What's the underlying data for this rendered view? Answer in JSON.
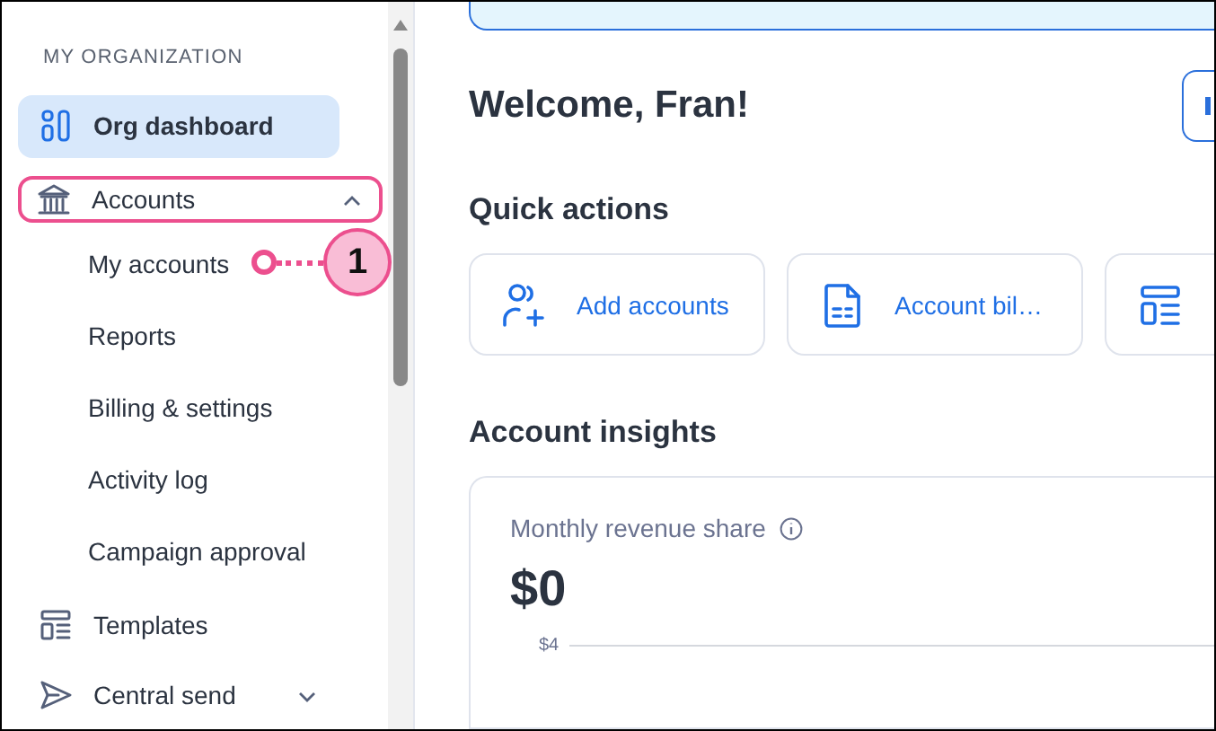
{
  "sidebar": {
    "section_label": "MY ORGANIZATION",
    "items": [
      {
        "kind": "dashboard",
        "label": "Org dashboard",
        "selected": true
      },
      {
        "kind": "bank",
        "label": "Accounts",
        "selected": false,
        "expanded": true,
        "highlighted": true,
        "children": [
          {
            "label": "My accounts",
            "selected": false
          },
          {
            "label": "Reports",
            "selected": false
          },
          {
            "label": "Billing & settings",
            "selected": false
          },
          {
            "label": "Activity log",
            "selected": false
          },
          {
            "label": "Campaign approval",
            "selected": false
          }
        ]
      },
      {
        "kind": "layout",
        "label": "Templates",
        "selected": false
      },
      {
        "kind": "send",
        "label": "Central send",
        "selected": false,
        "expanded": false
      }
    ]
  },
  "callout": {
    "number": "1"
  },
  "main": {
    "welcome": "Welcome, Fran!",
    "quick_actions": {
      "title": "Quick actions",
      "items": [
        {
          "kind": "add-people",
          "label": "Add accounts"
        },
        {
          "kind": "document",
          "label": "Account bil…"
        },
        {
          "kind": "layout"
        }
      ]
    },
    "insights": {
      "title": "Account insights",
      "card": {
        "title": "Monthly revenue share",
        "value": "$0",
        "axis_tick": "$4"
      }
    }
  }
}
